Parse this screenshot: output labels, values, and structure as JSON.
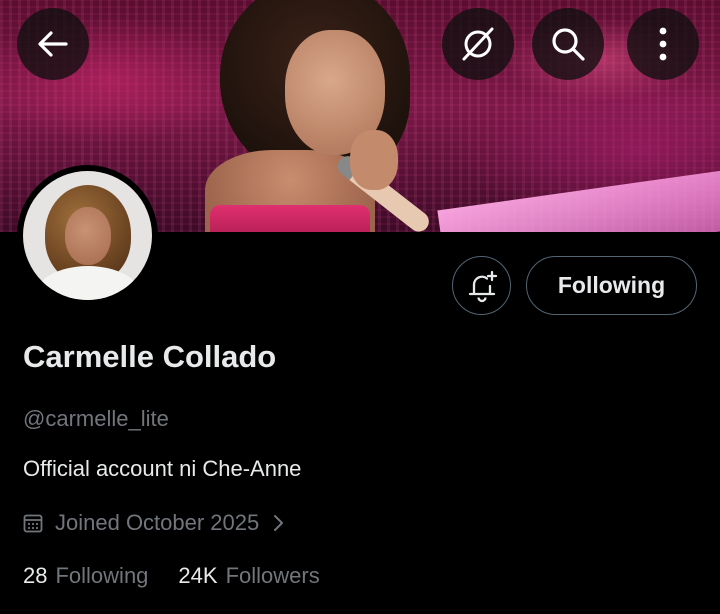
{
  "profile": {
    "display_name": "Carmelle Collado",
    "handle": "@carmelle_lite",
    "bio": "Official account ni Che-Anne",
    "joined": "Joined October 2025"
  },
  "actions": {
    "follow_state_label": "Following"
  },
  "stats": {
    "following_count": "28",
    "following_label": "Following",
    "followers_count": "24K",
    "followers_label": "Followers"
  },
  "icons": {
    "back": "back-arrow-icon",
    "grok": "grok-icon",
    "search": "search-icon",
    "more": "more-vertical-icon",
    "notify": "bell-plus-icon",
    "calendar": "calendar-icon",
    "chevron": "chevron-right-icon"
  },
  "colors": {
    "background": "#000000",
    "primary_text": "#e7e9ea",
    "secondary_text": "#71767b",
    "border": "#536471"
  }
}
